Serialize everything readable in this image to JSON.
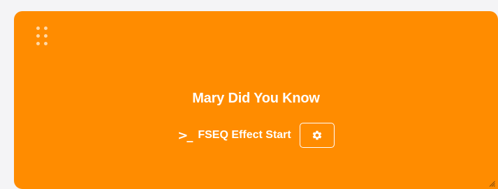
{
  "card": {
    "title": "Mary Did You Know",
    "command_icon": ">_",
    "command_label": "FSEQ Effect Start",
    "settings_icon": "gear-icon",
    "drag_icon": "drag-handle-icon",
    "resize_icon": "resize-grip-icon",
    "colors": {
      "card_background": "#ff8c00",
      "text": "#ffffff",
      "page_background": "#f4f4f6"
    }
  }
}
